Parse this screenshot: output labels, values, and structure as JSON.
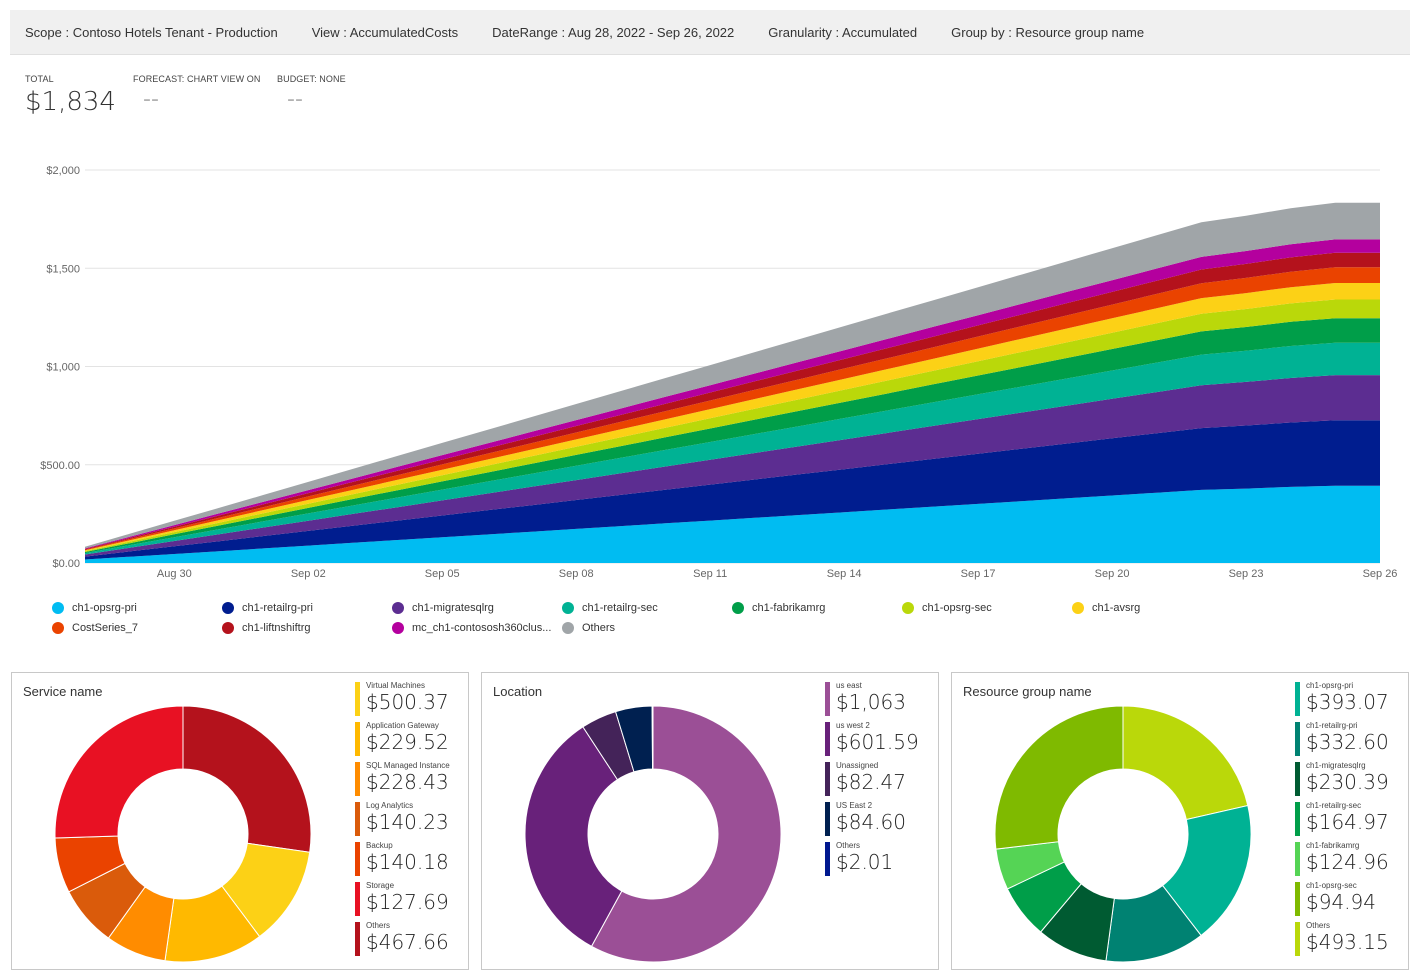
{
  "toolbar": {
    "scope": "Scope : Contoso Hotels Tenant - Production",
    "view": "View : AccumulatedCosts",
    "date_range": "DateRange : Aug 28, 2022 - Sep 26, 2022",
    "granularity": "Granularity : Accumulated",
    "group_by": "Group by : Resource group name"
  },
  "kpis": {
    "total_label": "TOTAL",
    "total_value": "$1,834",
    "forecast_label": "FORECAST: CHART VIEW ON",
    "forecast_value": "--",
    "budget_label": "BUDGET: NONE",
    "budget_value": "--"
  },
  "chart_data": [
    {
      "type": "area",
      "stacked": true,
      "title": "",
      "y_ticks": [
        "$0.00",
        "$500.00",
        "$1,000",
        "$1,500",
        "$2,000"
      ],
      "ylim": [
        0,
        2000
      ],
      "x_tick_labels": [
        "Aug 30",
        "Sep 02",
        "Sep 05",
        "Sep 08",
        "Sep 11",
        "Sep 14",
        "Sep 17",
        "Sep 20",
        "Sep 23",
        "Sep 26"
      ],
      "x_range": [
        "Aug 28",
        "Sep 26"
      ],
      "grid": true,
      "legend_position": "bottom",
      "series": [
        {
          "name": "ch1-opsrg-pri",
          "color": "#00bcf2",
          "end": 393
        },
        {
          "name": "ch1-retailrg-pri",
          "color": "#001d8f",
          "end": 333
        },
        {
          "name": "ch1-migratesqlrg",
          "color": "#5c2d91",
          "end": 230
        },
        {
          "name": "ch1-retailrg-sec",
          "color": "#00b294",
          "end": 165
        },
        {
          "name": "ch1-fabrikamrg",
          "color": "#009e49",
          "end": 125
        },
        {
          "name": "ch1-opsrg-sec",
          "color": "#bad80a",
          "end": 95
        },
        {
          "name": "ch1-avsrg",
          "color": "#fcd116",
          "end": 84
        },
        {
          "name": "CostSeries_7",
          "color": "#ea4300",
          "end": 80
        },
        {
          "name": "ch1-liftnshiftrg",
          "color": "#b4121c",
          "end": 74
        },
        {
          "name": "mc_ch1-contososh360clus...",
          "color": "#b4009e",
          "end": 68
        },
        {
          "name": "Others",
          "color": "#a0a5a8",
          "end": 186
        }
      ]
    },
    {
      "type": "pie",
      "donut": true,
      "title": "Service name",
      "series": [
        {
          "name": "Virtual Machines",
          "value": 500.37,
          "label": "$500.37",
          "color": "#b4121c"
        },
        {
          "name": "Application Gateway",
          "value": 229.52,
          "label": "$229.52",
          "color": "#fcd116"
        },
        {
          "name": "SQL Managed Instance",
          "value": 228.43,
          "label": "$228.43",
          "color": "#ffb900"
        },
        {
          "name": "Log Analytics",
          "value": 140.23,
          "label": "$140.23",
          "color": "#ff8c00"
        },
        {
          "name": "Backup",
          "value": 140.18,
          "label": "$140.18",
          "color": "#da5b0b"
        },
        {
          "name": "Storage",
          "value": 127.69,
          "label": "$127.69",
          "color": "#ea4300"
        },
        {
          "name": "Others",
          "value": 467.66,
          "label": "$467.66",
          "color": "#e81123"
        }
      ],
      "list_colors": [
        "#fcd116",
        "#ffb900",
        "#ff8c00",
        "#da5b0b",
        "#ea4300",
        "#e81123",
        "#b4121c"
      ]
    },
    {
      "type": "pie",
      "donut": true,
      "title": "Location",
      "series": [
        {
          "name": "us east",
          "value": 1063,
          "label": "$1,063",
          "color": "#9b4f96"
        },
        {
          "name": "us west 2",
          "value": 601.59,
          "label": "$601.59",
          "color": "#68217a"
        },
        {
          "name": "Unassigned",
          "value": 82.47,
          "label": "$82.47",
          "color": "#442359"
        },
        {
          "name": "US East 2",
          "value": 84.6,
          "label": "$84.60",
          "color": "#002050"
        },
        {
          "name": "Others",
          "value": 2.01,
          "label": "$2.01",
          "color": "#00188f"
        }
      ],
      "list_colors": [
        "#9b4f96",
        "#68217a",
        "#442359",
        "#002050",
        "#00188f"
      ]
    },
    {
      "type": "pie",
      "donut": true,
      "title": "Resource group name",
      "series": [
        {
          "name": "ch1-opsrg-pri",
          "value": 393.07,
          "label": "$393.07",
          "color": "#bad80a"
        },
        {
          "name": "ch1-retailrg-pri",
          "value": 332.6,
          "label": "$332.60",
          "color": "#00b294"
        },
        {
          "name": "ch1-migratesqlrg",
          "value": 230.39,
          "label": "$230.39",
          "color": "#008272"
        },
        {
          "name": "ch1-retailrg-sec",
          "value": 164.97,
          "label": "$164.97",
          "color": "#005b32"
        },
        {
          "name": "ch1-fabrikamrg",
          "value": 124.96,
          "label": "$124.96",
          "color": "#009e49"
        },
        {
          "name": "ch1-opsrg-sec",
          "value": 94.94,
          "label": "$94.94",
          "color": "#55d455"
        },
        {
          "name": "Others",
          "value": 493.15,
          "label": "$493.15",
          "color": "#7fba00"
        }
      ],
      "list_colors": [
        "#00b294",
        "#008272",
        "#005b32",
        "#009e49",
        "#55d455",
        "#7fba00",
        "#bad80a"
      ]
    }
  ],
  "service_panel": {
    "title": "Service name",
    "items": [
      {
        "name": "Virtual Machines",
        "amount": "$500.37"
      },
      {
        "name": "Application Gateway",
        "amount": "$229.52"
      },
      {
        "name": "SQL Managed Instance",
        "amount": "$228.43"
      },
      {
        "name": "Log Analytics",
        "amount": "$140.23"
      },
      {
        "name": "Backup",
        "amount": "$140.18"
      },
      {
        "name": "Storage",
        "amount": "$127.69"
      },
      {
        "name": "Others",
        "amount": "$467.66"
      }
    ]
  },
  "location_panel": {
    "title": "Location",
    "items": [
      {
        "name": "us east",
        "amount": "$1,063"
      },
      {
        "name": "us west 2",
        "amount": "$601.59"
      },
      {
        "name": "Unassigned",
        "amount": "$82.47"
      },
      {
        "name": "US East 2",
        "amount": "$84.60"
      },
      {
        "name": "Others",
        "amount": "$2.01"
      }
    ]
  },
  "rg_panel": {
    "title": "Resource group name",
    "items": [
      {
        "name": "ch1-opsrg-pri",
        "amount": "$393.07"
      },
      {
        "name": "ch1-retailrg-pri",
        "amount": "$332.60"
      },
      {
        "name": "ch1-migratesqlrg",
        "amount": "$230.39"
      },
      {
        "name": "ch1-retailrg-sec",
        "amount": "$164.97"
      },
      {
        "name": "ch1-fabrikamrg",
        "amount": "$124.96"
      },
      {
        "name": "ch1-opsrg-sec",
        "amount": "$94.94"
      },
      {
        "name": "Others",
        "amount": "$493.15"
      }
    ]
  }
}
